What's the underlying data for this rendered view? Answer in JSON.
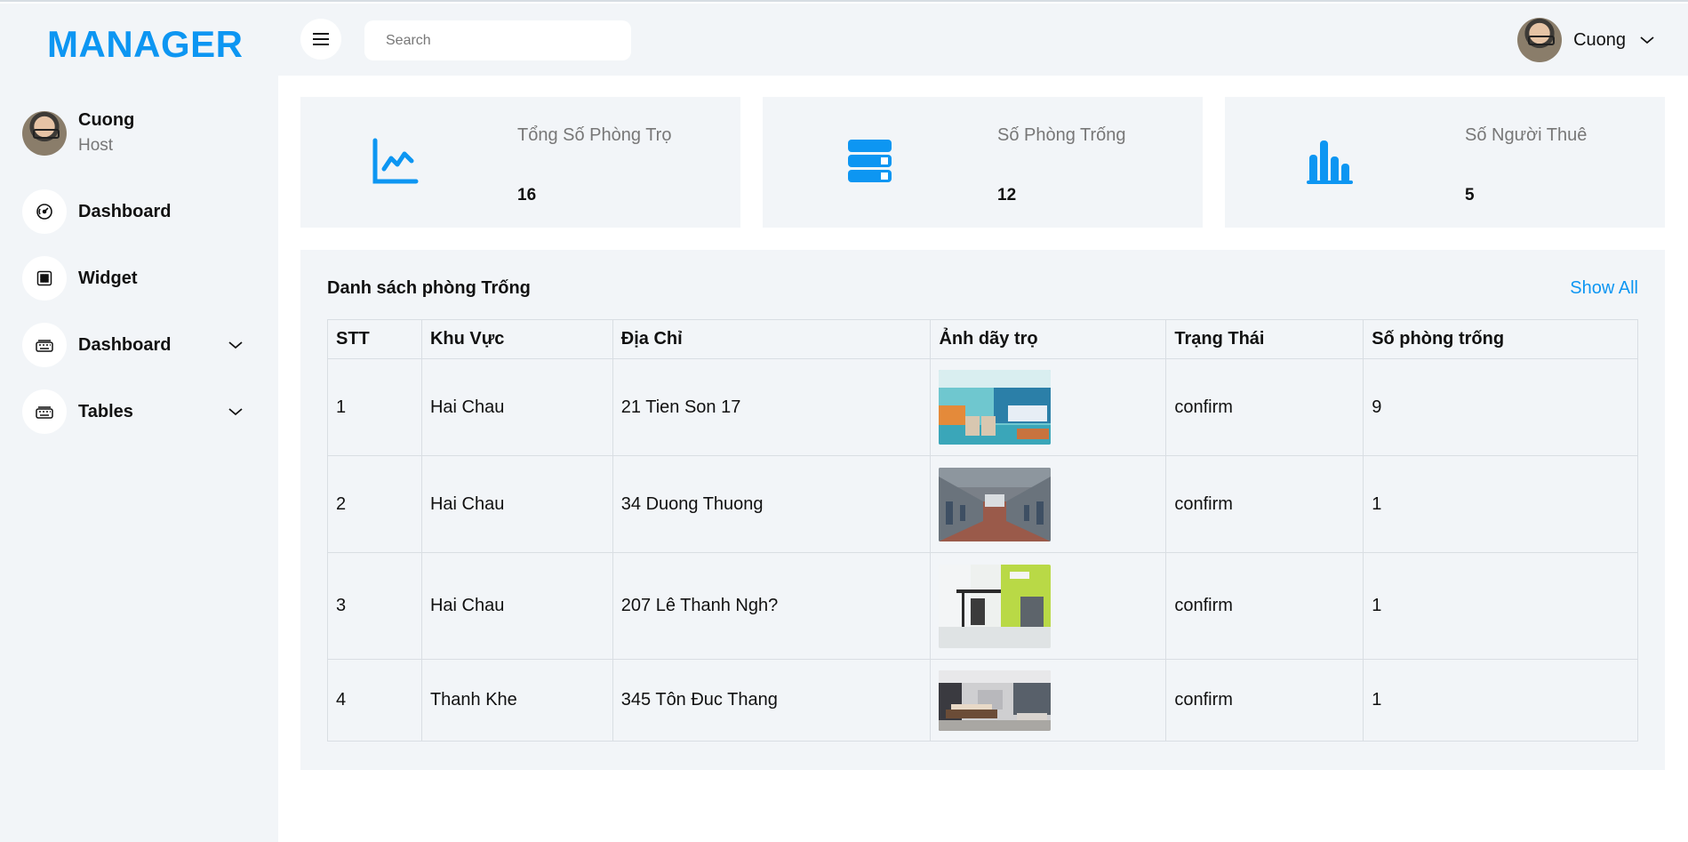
{
  "brand": "MANAGER",
  "profile": {
    "name": "Cuong",
    "role": "Host"
  },
  "nav": [
    {
      "label": "Dashboard",
      "icon": "gauge-icon",
      "has_chevron": false
    },
    {
      "label": "Widget",
      "icon": "grid-icon",
      "has_chevron": false
    },
    {
      "label": "Dashboard",
      "icon": "keyboard-icon",
      "has_chevron": true
    },
    {
      "label": "Tables",
      "icon": "keyboard-icon",
      "has_chevron": true
    }
  ],
  "header": {
    "search_placeholder": "Search",
    "user_name": "Cuong"
  },
  "stats": [
    {
      "title": "Tổng Số Phòng Trọ",
      "value": "16",
      "icon": "line-chart-icon"
    },
    {
      "title": "Số Phòng Trống",
      "value": "12",
      "icon": "server-icon"
    },
    {
      "title": "Số Người Thuê",
      "value": "5",
      "icon": "bar-chart-icon"
    }
  ],
  "panel": {
    "title": "Danh sách phòng Trống",
    "show_all": "Show All",
    "columns": [
      "STT",
      "Khu Vực",
      "Địa Chỉ",
      "Ảnh dãy trọ",
      "Trạng Thái",
      "Số phòng trống"
    ],
    "rows": [
      {
        "stt": "1",
        "area": "Hai Chau",
        "address": "21 Tien Son 17",
        "status": "confirm",
        "empty_rooms": "9"
      },
      {
        "stt": "2",
        "area": "Hai Chau",
        "address": "34 Duong Thuong",
        "status": "confirm",
        "empty_rooms": "1"
      },
      {
        "stt": "3",
        "area": "Hai Chau",
        "address": "207 Lê Thanh Ngh?",
        "status": "confirm",
        "empty_rooms": "1"
      },
      {
        "stt": "4",
        "area": "Thanh Khe",
        "address": "345 Tôn Đuc Thang",
        "status": "confirm",
        "empty_rooms": "1"
      }
    ]
  },
  "colors": {
    "accent": "#0d96f2",
    "panel_bg": "#f2f5f8",
    "muted_text": "#777777"
  }
}
